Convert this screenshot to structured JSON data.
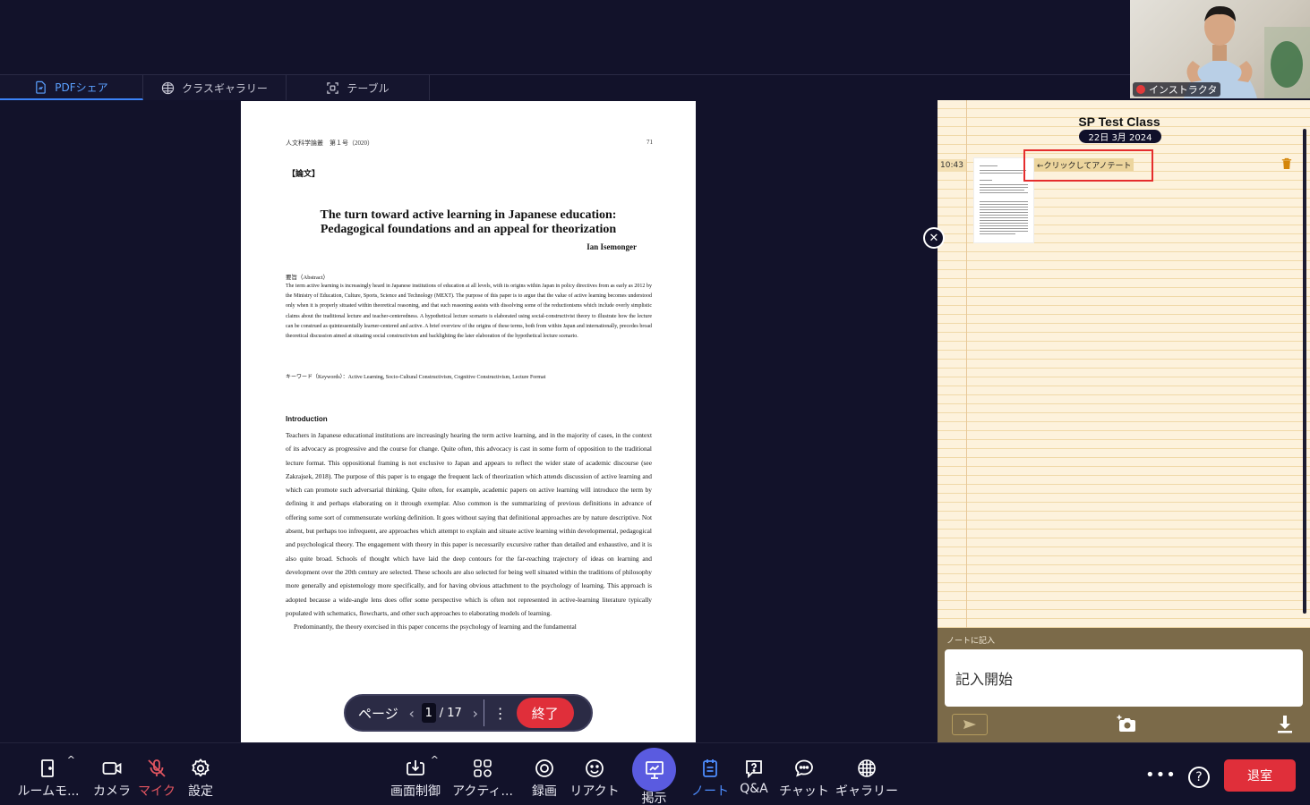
{
  "tabs": [
    {
      "label": "PDFシェア",
      "icon": "pdf-share-icon"
    },
    {
      "label": "クラスギャラリー",
      "icon": "grid-icon"
    },
    {
      "label": "テーブル",
      "icon": "table-icon"
    }
  ],
  "pdf": {
    "header_left": "人文科学論叢　第１号（2020）",
    "header_right": "71",
    "tag": "【論文】",
    "title_line1": "The turn toward active learning in Japanese education:",
    "title_line2": "Pedagogical foundations and an appeal for theorization",
    "author": "Ian Isemonger",
    "abstract_heading": "要旨（Abstract）",
    "abstract": "The term active learning is increasingly heard in Japanese institutions of education at all levels, with its origins within Japan in policy directives from as early as 2012 by the Ministry of Education, Culture, Sports, Science and Technology (MEXT). The purpose of this paper is to argue that the value of active learning becomes understood only when it is properly situated within theoretical reasoning, and that such reasoning assists with dissolving some of the reductionisms which include overly simplistic claims about the traditional lecture and teacher-centeredness. A hypothetical lecture scenario is elaborated using social-constructivist theory to illustrate how the lecture can be construed as quintessentially learner-centered and active. A brief overview of the origins of these terms, both from within Japan and internationally, precedes broad theoretical discussion aimed at situating social constructivism and backlighting the later elaboration of the hypothetical lecture scenario.",
    "keywords": "キーワード（Keywords）：Active Learning, Socio-Cultural Constructivism, Cognitive Constructivism, Lecture Format",
    "intro_heading": "Introduction",
    "body": "Teachers in Japanese educational institutions are increasingly hearing the term active learning, and in the majority of cases, in the context of its advocacy as progressive and the course for change. Quite often, this advocacy is cast in some form of opposition to the traditional lecture format. This oppositional framing is not exclusive to Japan and appears to reflect the wider state of academic discourse (see Zakrajsek, 2018). The purpose of this paper is to engage the frequent lack of theorization which attends discussion of active learning and which can promote such adversarial thinking. Quite often, for example, academic papers on active learning will introduce the term by defining it and perhaps elaborating on it through exemplar. Also common is the summarizing of previous definitions in advance of offering some sort of commensurate working definition. It goes without saying that definitional approaches are by nature descriptive. Not absent, but perhaps too infrequent, are approaches which attempt to explain and situate active learning within developmental, pedagogical and psychological theory. The engagement with theory in this paper is necessarily excursive rather than detailed and exhaustive, and it is also quite broad. Schools of thought which have laid the deep contours for the far-reaching trajectory of ideas on learning and development over the 20th century are selected. These schools are also selected for being well situated within the traditions of philosophy more generally and epistemology more specifically, and for having obvious attachment to the psychology of learning. This approach is adopted because a wide-angle lens does offer some perspective which is often not represented in active-learning literature typically populated with schematics, flowcharts, and other such approaches to elaborating models of learning.",
    "body2": "Predominantly, the theory exercised in this paper concerns the psychology of learning and the fundamental"
  },
  "page_control": {
    "label": "ページ",
    "current": "1",
    "total": "/ 17",
    "end_label": "終了"
  },
  "notes": {
    "class_title": "SP Test Class",
    "date": "22日 3月 2024",
    "entry_time": "10:43",
    "annotate_hint": "←クリックしてアノテート",
    "input_header": "ノートに記入",
    "input_placeholder": "記入開始"
  },
  "video": {
    "participant_label": "インストラクタ"
  },
  "toolbar": {
    "room_mode": "ルームモ...",
    "camera": "カメラ",
    "mic": "マイク",
    "settings": "設定",
    "screen_control": "画面制御",
    "activity": "アクティ...",
    "record": "録画",
    "react": "リアクト",
    "present": "掲示",
    "note": "ノート",
    "qa": "Q&A",
    "chat": "チャット",
    "gallery": "ギャラリー",
    "leave": "退室"
  },
  "colors": {
    "background": "#12122a",
    "accent": "#3b82f6",
    "danger": "#e02f3a",
    "present": "#5a5be0",
    "note_paper": "#fdf2dc",
    "highlight_box": "#e52d2d"
  }
}
